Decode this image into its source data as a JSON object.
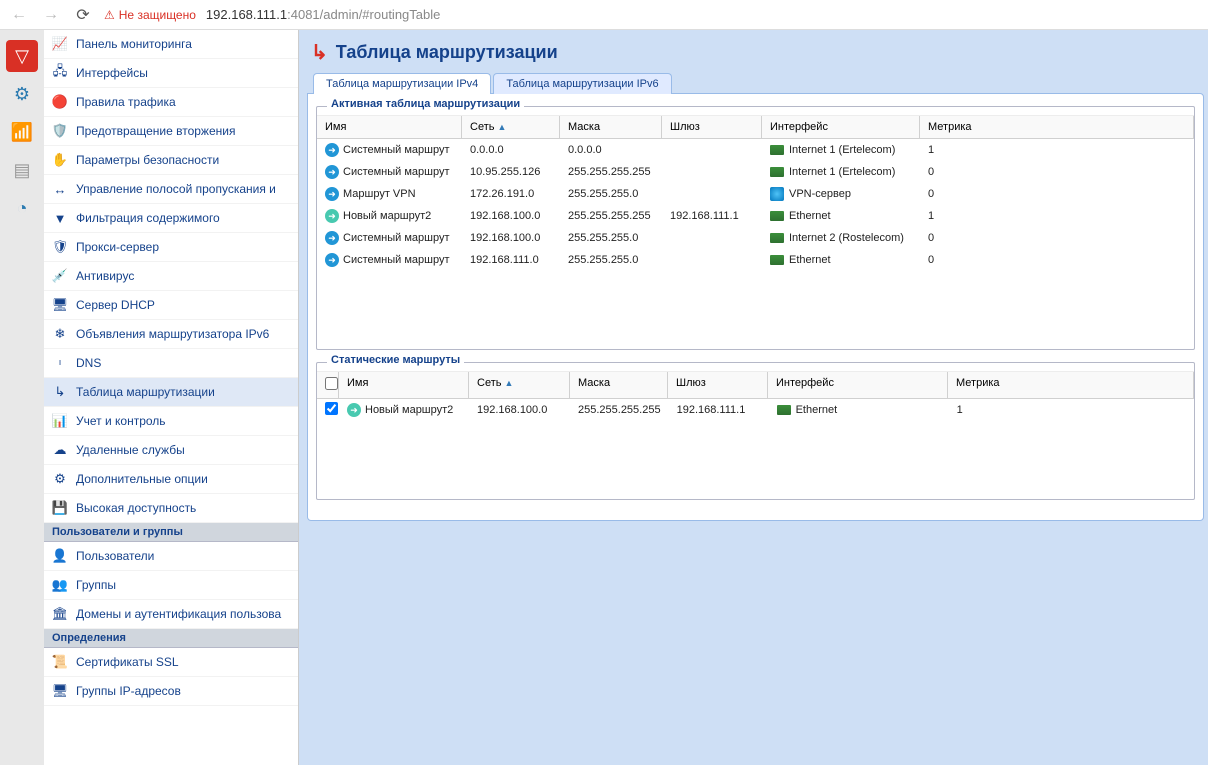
{
  "browser": {
    "security_label": "Не защищено",
    "url_host": "192.168.111.1",
    "url_port": ":4081",
    "url_path": "/admin/#routingTable"
  },
  "sidebar": {
    "items": [
      {
        "label": "Панель мониторинга",
        "icon": "📈"
      },
      {
        "label": "Интерфейсы",
        "icon": "🖧"
      },
      {
        "label": "Правила трафика",
        "icon": "🔴"
      },
      {
        "label": "Предотвращение вторжения",
        "icon": "🛡️"
      },
      {
        "label": "Параметры безопасности",
        "icon": "✋"
      },
      {
        "label": "Управление полосой пропускания и",
        "icon": "↔"
      },
      {
        "label": "Фильтрация содержимого",
        "icon": "▼"
      },
      {
        "label": "Прокси-сервер",
        "icon": "🛡"
      },
      {
        "label": "Антивирус",
        "icon": "💉"
      },
      {
        "label": "Сервер DHCP",
        "icon": "🖥"
      },
      {
        "label": "Объявления маршрутизатора IPv6",
        "icon": "❄"
      },
      {
        "label": "DNS",
        "icon": "ᶥ"
      },
      {
        "label": "Таблица маршрутизации",
        "icon": "↳",
        "selected": true
      },
      {
        "label": "Учет и контроль",
        "icon": "📊"
      },
      {
        "label": "Удаленные службы",
        "icon": "☁"
      },
      {
        "label": "Дополнительные опции",
        "icon": "⚙"
      },
      {
        "label": "Высокая доступность",
        "icon": "💾"
      }
    ],
    "section_users": "Пользователи и группы",
    "users": [
      {
        "label": "Пользователи",
        "icon": "👤"
      },
      {
        "label": "Группы",
        "icon": "👥"
      },
      {
        "label": "Домены и аутентификация пользова",
        "icon": "🏛"
      }
    ],
    "section_defs": "Определения",
    "defs": [
      {
        "label": "Сертификаты SSL",
        "icon": "📜"
      },
      {
        "label": "Группы IP-адресов",
        "icon": "🖥"
      }
    ]
  },
  "page": {
    "title": "Таблица маршрутизации",
    "tabs": [
      {
        "label": "Таблица маршрутизации IPv4",
        "active": true
      },
      {
        "label": "Таблица маршрутизации IPv6",
        "active": false
      }
    ],
    "active_legend": "Активная таблица маршрутизации",
    "static_legend": "Статические маршруты",
    "cols": {
      "name": "Имя",
      "net": "Сеть",
      "mask": "Маска",
      "gw": "Шлюз",
      "if": "Интерфейс",
      "met": "Метрика"
    },
    "active_rows": [
      {
        "name": "Системный маршрут",
        "net": "0.0.0.0",
        "mask": "0.0.0.0",
        "gw": "",
        "if": "Internet 1 (Ertelecom)",
        "met": "1",
        "iconClass": ""
      },
      {
        "name": "Системный маршрут",
        "net": "10.95.255.126",
        "mask": "255.255.255.255",
        "gw": "",
        "if": "Internet 1 (Ertelecom)",
        "met": "0",
        "iconClass": ""
      },
      {
        "name": "Маршрут VPN",
        "net": "172.26.191.0",
        "mask": "255.255.255.0",
        "gw": "",
        "if": "VPN-сервер",
        "met": "0",
        "iconClass": "",
        "ifIcon": "vpn"
      },
      {
        "name": "Новый маршрут2",
        "net": "192.168.100.0",
        "mask": "255.255.255.255",
        "gw": "192.168.111.1",
        "if": "Ethernet",
        "met": "1",
        "iconClass": "alt"
      },
      {
        "name": "Системный маршрут",
        "net": "192.168.100.0",
        "mask": "255.255.255.0",
        "gw": "",
        "if": "Internet 2 (Rostelecom)",
        "met": "0",
        "iconClass": ""
      },
      {
        "name": "Системный маршрут",
        "net": "192.168.111.0",
        "mask": "255.255.255.0",
        "gw": "",
        "if": "Ethernet",
        "met": "0",
        "iconClass": ""
      }
    ],
    "static_rows": [
      {
        "checked": true,
        "name": "Новый маршрут2",
        "net": "192.168.100.0",
        "mask": "255.255.255.255",
        "gw": "192.168.111.1",
        "if": "Ethernet",
        "met": "1"
      }
    ]
  }
}
